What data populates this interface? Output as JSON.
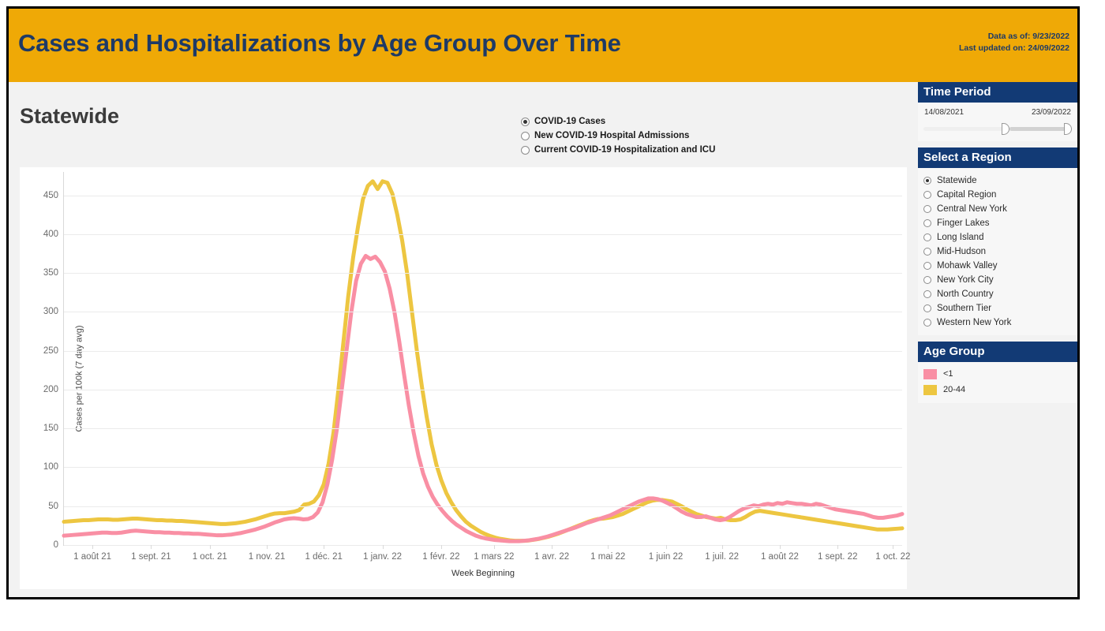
{
  "header": {
    "title": "Cases and Hospitalizations by Age Group Over Time",
    "data_as_of": "Data as of: 9/23/2022",
    "last_updated": "Last updated on: 24/09/2022",
    "bg_color": "#efa906",
    "text_color": "#1e3a66"
  },
  "main": {
    "region_title": "Statewide",
    "measures": [
      {
        "label": "COVID-19 Cases",
        "selected": true
      },
      {
        "label": "New COVID-19 Hospital Admissions",
        "selected": false
      },
      {
        "label": "Current COVID-19 Hospitalization and ICU",
        "selected": false
      }
    ]
  },
  "time_period": {
    "panel_title": "Time Period",
    "start_date": "14/08/2021",
    "end_date": "23/09/2022",
    "left_handle_pct": 58,
    "right_handle_pct": 100
  },
  "region_panel": {
    "panel_title": "Select a Region",
    "options": [
      {
        "label": "Statewide",
        "selected": true
      },
      {
        "label": "Capital Region",
        "selected": false
      },
      {
        "label": "Central New York",
        "selected": false
      },
      {
        "label": "Finger Lakes",
        "selected": false
      },
      {
        "label": "Long Island",
        "selected": false
      },
      {
        "label": "Mid-Hudson",
        "selected": false
      },
      {
        "label": "Mohawk Valley",
        "selected": false
      },
      {
        "label": "New York City",
        "selected": false
      },
      {
        "label": "North Country",
        "selected": false
      },
      {
        "label": "Southern Tier",
        "selected": false
      },
      {
        "label": "Western New York",
        "selected": false
      }
    ]
  },
  "age_group_panel": {
    "panel_title": "Age Group",
    "entries": [
      {
        "label": "<1",
        "color": "#f98fa4"
      },
      {
        "label": "20-44",
        "color": "#edc641"
      }
    ]
  },
  "chart_data": {
    "type": "line",
    "title": "Statewide",
    "xlabel": "Week Beginning",
    "ylabel": "Cases per 100k (7 day avg)",
    "ylim": [
      0,
      480
    ],
    "yticks": [
      0,
      50,
      100,
      150,
      200,
      250,
      300,
      350,
      400,
      450
    ],
    "grid": true,
    "legend_position": "right-panel",
    "xticks": [
      "1 août 21",
      "1 sept. 21",
      "1 oct. 21",
      "1 nov. 21",
      "1 déc. 21",
      "1 janv. 22",
      "1 févr. 22",
      "1 mars 22",
      "1 avr. 22",
      "1 mai 22",
      "1 juin 22",
      "1 juil. 22",
      "1 août 22",
      "1 sept. 22",
      "1 oct. 22"
    ],
    "xtick_positions_pct": [
      3.4,
      10.4,
      17.4,
      24.2,
      31.0,
      38.0,
      45.0,
      51.3,
      58.2,
      64.9,
      71.8,
      78.5,
      85.4,
      92.3,
      98.9
    ],
    "x_start": "2021-08-14",
    "x_end": "2022-09-23",
    "series": [
      {
        "name": "<1",
        "color": "#f98fa4",
        "values": [
          12,
          12.5,
          13,
          13.5,
          14,
          14.5,
          15,
          15.5,
          16,
          16,
          15.5,
          15.5,
          16,
          17,
          18,
          18.5,
          18,
          17.5,
          17,
          16.5,
          16.5,
          16,
          16,
          15.5,
          15.5,
          15,
          15,
          14.5,
          14.5,
          14,
          13.5,
          13,
          12.5,
          12.5,
          13,
          13.5,
          14.5,
          15.5,
          17,
          18.5,
          20,
          22,
          24,
          26.5,
          29,
          31,
          33,
          34,
          34.5,
          34,
          33,
          33.5,
          36,
          42,
          55,
          78,
          110,
          150,
          200,
          250,
          300,
          340,
          362,
          372,
          368,
          371,
          364,
          352,
          330,
          300,
          262,
          220,
          180,
          145,
          115,
          92,
          75,
          62,
          52,
          44,
          37,
          31,
          26,
          22,
          18,
          15,
          12,
          10,
          8.5,
          7.5,
          6.5,
          6,
          5.5,
          5,
          5,
          5,
          5.5,
          6,
          7,
          8,
          9.5,
          11,
          13,
          15,
          17,
          19,
          21,
          23,
          25.5,
          28,
          30,
          32,
          34,
          36,
          38,
          41,
          44,
          47,
          50,
          53,
          56,
          58,
          60,
          60,
          59,
          57,
          54,
          51,
          47,
          43,
          40,
          38,
          36,
          36,
          37,
          35,
          33,
          32,
          33,
          36,
          40,
          44,
          47,
          49,
          51,
          50,
          52,
          53,
          52,
          54,
          53,
          55,
          54,
          53,
          53,
          52,
          51,
          53,
          52,
          50,
          48,
          46,
          45,
          44,
          43,
          42,
          41,
          40,
          38,
          36,
          35,
          35,
          36,
          37,
          38,
          40
        ],
        "peak_value": 372
      },
      {
        "name": "20-44",
        "color": "#edc641",
        "values": [
          30,
          30.5,
          31,
          31.5,
          32,
          32,
          32.5,
          33,
          33,
          33,
          32.5,
          32.5,
          33,
          33.5,
          34,
          34,
          33.5,
          33,
          32.5,
          32,
          32,
          31.5,
          31.5,
          31,
          31,
          30.5,
          30,
          29.5,
          29,
          28.5,
          28,
          27.5,
          27,
          27,
          27.5,
          28,
          29,
          30,
          31.5,
          33,
          35,
          37,
          39,
          40.5,
          41,
          41,
          42,
          43,
          45,
          52,
          53,
          56,
          64,
          78,
          105,
          145,
          200,
          260,
          320,
          370,
          410,
          445,
          462,
          468,
          458,
          468,
          466,
          452,
          425,
          392,
          350,
          300,
          250,
          205,
          165,
          130,
          103,
          83,
          67,
          55,
          45,
          37,
          30,
          25,
          21,
          17,
          14,
          11.5,
          9.5,
          8,
          7,
          6,
          5.5,
          5.5,
          5.5,
          6,
          7,
          8,
          9.5,
          11,
          13,
          15,
          17.5,
          20,
          22.5,
          25,
          27.5,
          30,
          32,
          33.5,
          34,
          35,
          36,
          38,
          40,
          43,
          46,
          49,
          52,
          55,
          57,
          58,
          58,
          57,
          56,
          53,
          50,
          46,
          43,
          40,
          38,
          36,
          35,
          34,
          35,
          33,
          32,
          32,
          33,
          36,
          40,
          43,
          44,
          43,
          42,
          41,
          40,
          39,
          38,
          37,
          36,
          35,
          34,
          33,
          32,
          31,
          30,
          29,
          28,
          27,
          26,
          25,
          24,
          23,
          22,
          21,
          20,
          20,
          20,
          20.5,
          21,
          21.5
        ],
        "peak_value": 470
      }
    ]
  }
}
